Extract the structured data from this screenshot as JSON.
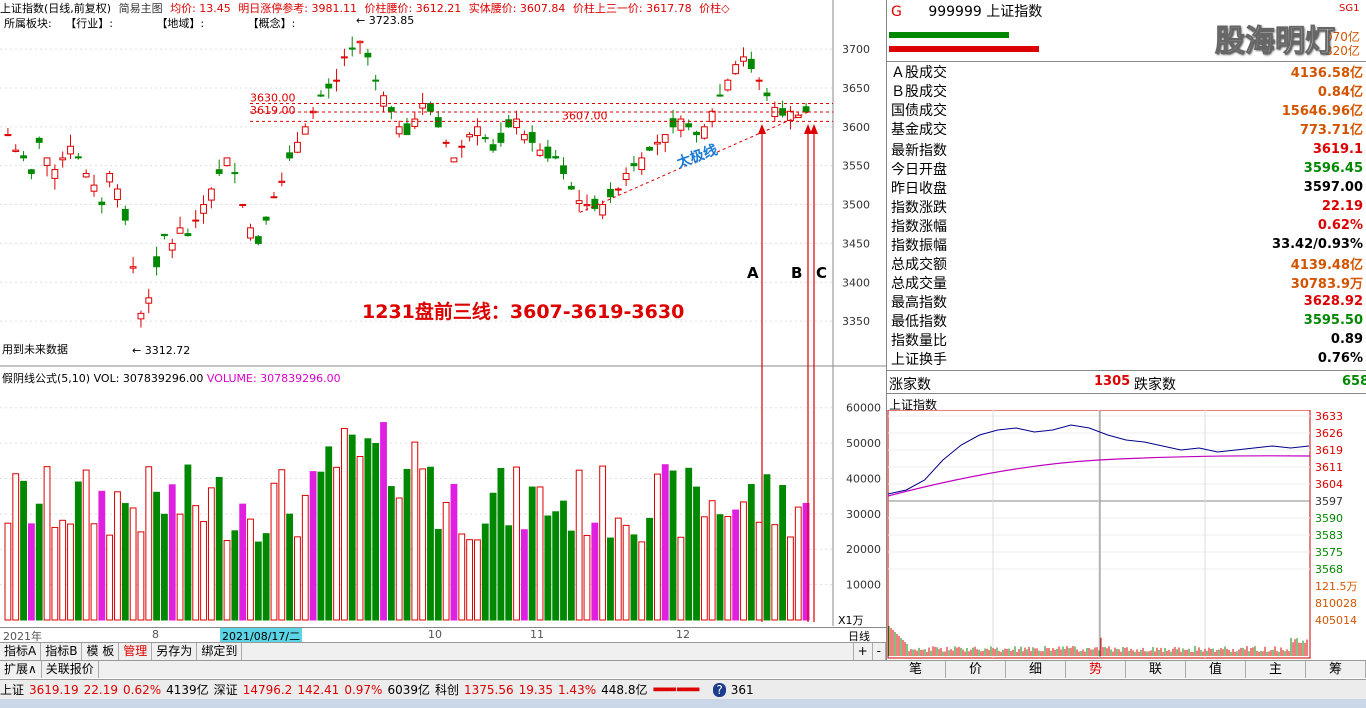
{
  "title_bar": {
    "index_name": "上证指数(日线,前复权)",
    "template": "简易主图",
    "avg_price": "均价: 13.45",
    "limit_ref": "明日涨停参考: 3981.11",
    "waist_price": "价柱腰价: 3612.21",
    "body_waist": "实体腰价: 3607.84",
    "third_price": "价柱上三一价: 3617.78",
    "price_label": "价柱◇"
  },
  "sectors": {
    "label": "所属板块:",
    "industry": "【行业】:",
    "region": "【地域】:",
    "concept": "【概念】:"
  },
  "price_axis": [
    "3700",
    "3650",
    "3600",
    "3550",
    "3500",
    "3450",
    "3400",
    "3350"
  ],
  "price_markers": {
    "high": "3723.85",
    "low": "3312.72",
    "l1": "3630.00",
    "l2": "3619.00",
    "l3": "3607.00"
  },
  "future_data": "用到未来数据",
  "annotation": "1231盘前三线：3607-3619-3630",
  "trend_label": "太极线",
  "arrow_labels": [
    "A",
    "B",
    "C"
  ],
  "volume_header": {
    "name": "假阴线公式(5,10)",
    "vol": "VOL: 307839296.00",
    "volume": "VOLUME: 307839296.00"
  },
  "volume_axis": [
    "60000",
    "50000",
    "40000",
    "30000",
    "20000",
    "10000"
  ],
  "volume_unit": "X1万",
  "x_axis": {
    "year": "2021年",
    "m8": "8",
    "cursor_date": "2021/08/17/二",
    "m10": "10",
    "m11": "11",
    "m12": "12",
    "period": "日线"
  },
  "tabs1": [
    "指标A",
    "指标B",
    "模 板",
    "管理",
    "另存为",
    "绑定到"
  ],
  "tabs2": [
    "扩展∧",
    "关联报价"
  ],
  "right": {
    "code_letter": "G",
    "code": "999999",
    "name": "上证指数",
    "top_values": [
      "070亿",
      "820亿"
    ],
    "watermark": "股海明灯",
    "corner": "SG1",
    "rows": [
      {
        "label": "Ａ股成交",
        "value": "4136.58亿",
        "color": "orange"
      },
      {
        "label": "Ｂ股成交",
        "value": "0.84亿",
        "color": "orange"
      },
      {
        "label": "国债成交",
        "value": "15646.96亿",
        "color": "orange"
      },
      {
        "label": "基金成交",
        "value": "773.71亿",
        "color": "orange"
      },
      {
        "label": "最新指数",
        "value": "3619.1",
        "color": "red"
      },
      {
        "label": "今日开盘",
        "value": "3596.45",
        "color": "green"
      },
      {
        "label": "昨日收盘",
        "value": "3597.00",
        "color": "black"
      },
      {
        "label": "指数涨跌",
        "value": "22.19",
        "color": "red"
      },
      {
        "label": "指数涨幅",
        "value": "0.62%",
        "color": "red"
      },
      {
        "label": "指数振幅",
        "value": "33.42/0.93%",
        "color": "black"
      },
      {
        "label": "总成交额",
        "value": "4139.48亿",
        "color": "orange"
      },
      {
        "label": "总成交量",
        "value": "30783.9万",
        "color": "orange"
      },
      {
        "label": "最高指数",
        "value": "3628.92",
        "color": "red"
      },
      {
        "label": "最低指数",
        "value": "3595.50",
        "color": "green"
      },
      {
        "label": "指数量比",
        "value": "0.89",
        "color": "black"
      },
      {
        "label": "上证换手",
        "value": "0.76%",
        "color": "black"
      }
    ],
    "up_label": "涨家数",
    "up_count": "1305",
    "down_label": "跌家数",
    "down_count": "658",
    "intraday_title": "上证指数",
    "intraday_axis": [
      "3633",
      "3626",
      "3619",
      "3611",
      "3604",
      "3597",
      "3590",
      "3583",
      "3575",
      "3568"
    ],
    "intraday_vol_axis": [
      "121.5万",
      "810028",
      "405014"
    ],
    "tabs": [
      "笔",
      "价",
      "细",
      "势",
      "联",
      "值",
      "主",
      "筹"
    ]
  },
  "status": {
    "sh_name": "上证",
    "sh_price": "3619.19",
    "sh_chg": "22.19",
    "sh_pct": "0.62%",
    "sh_amt": "4139亿",
    "sz_name": "深证",
    "sz_price": "14796.2",
    "sz_chg": "142.41",
    "sz_pct": "0.97%",
    "sz_amt": "6039亿",
    "kc_name": "科创",
    "kc_price": "1375.56",
    "kc_chg": "19.35",
    "kc_pct": "1.43%",
    "kc_amt": "448.8亿",
    "extra": "361"
  }
}
